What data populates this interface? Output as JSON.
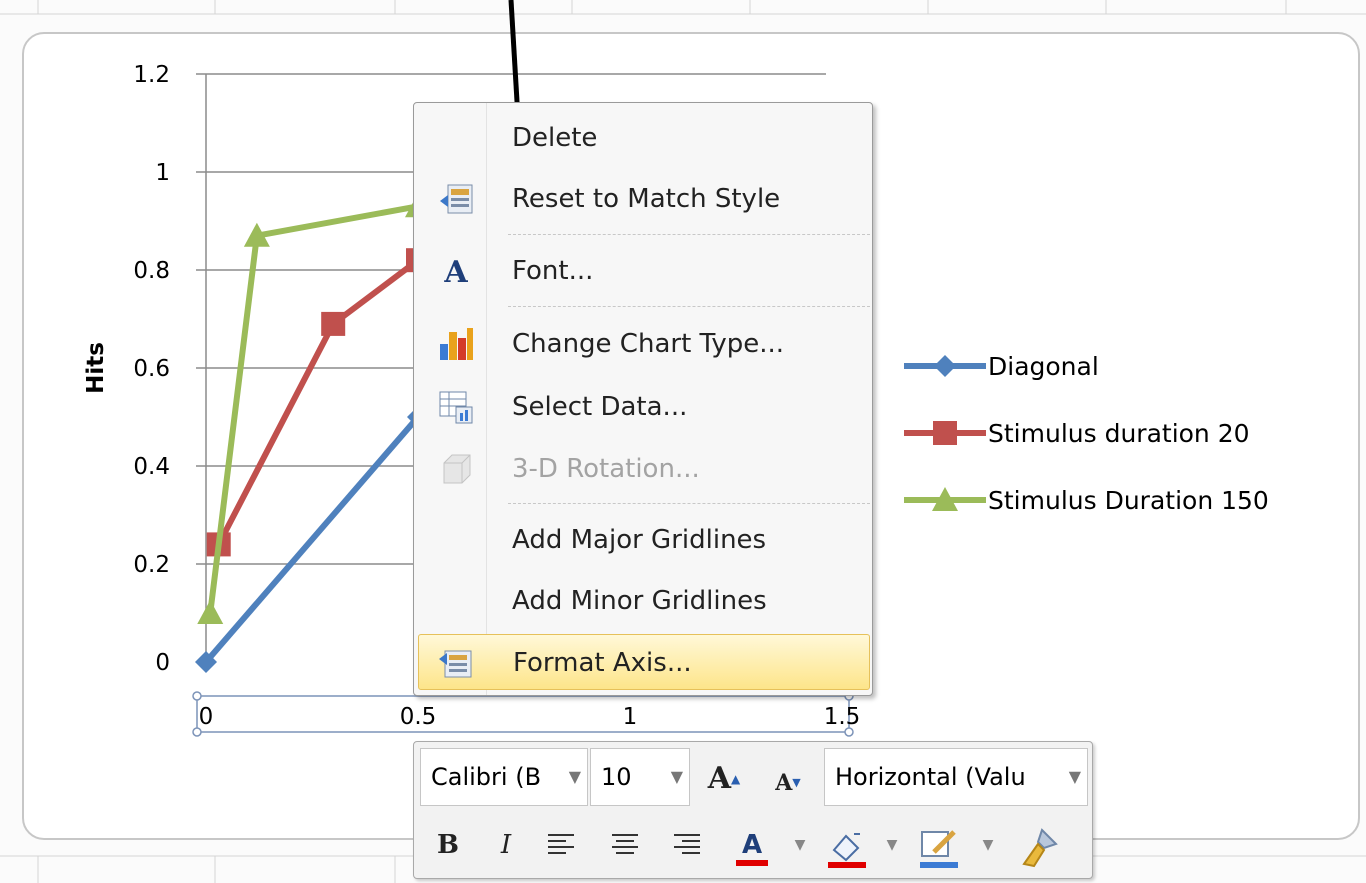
{
  "chart_data": {
    "type": "line",
    "ylabel": "Hits",
    "xlim": [
      0,
      1.5
    ],
    "ylim": [
      0,
      1.2
    ],
    "x_ticks": [
      "0",
      "0.5",
      "1",
      "1.5"
    ],
    "y_ticks": [
      "0",
      "0.2",
      "0.4",
      "0.6",
      "0.8",
      "1",
      "1.2"
    ],
    "legend_position": "right",
    "series": [
      {
        "name": "Diagonal",
        "color": "#4f81bd",
        "marker": "diamond",
        "points": [
          [
            0,
            0
          ],
          [
            0.5,
            0.5
          ]
        ]
      },
      {
        "name": "Stimulus duration 20",
        "color": "#c0504d",
        "marker": "square",
        "points": [
          [
            0.03,
            0.24
          ],
          [
            0.3,
            0.69
          ],
          [
            0.5,
            0.82
          ]
        ]
      },
      {
        "name": "Stimulus Duration 150",
        "color": "#9bbb59",
        "marker": "triangle",
        "points": [
          [
            0.01,
            0.1
          ],
          [
            0.12,
            0.87
          ],
          [
            0.5,
            0.93
          ]
        ]
      }
    ]
  },
  "context_menu": {
    "items": [
      {
        "label": "Delete",
        "icon": "none"
      },
      {
        "label": "Reset to Match Style",
        "icon": "reset-style-icon"
      },
      {
        "label": "Font...",
        "icon": "font-icon"
      },
      {
        "label": "Change Chart Type...",
        "icon": "chart-type-icon"
      },
      {
        "label": "Select Data...",
        "icon": "select-data-icon"
      },
      {
        "label": "3-D Rotation...",
        "icon": "rotation-3d-icon",
        "disabled": true
      },
      {
        "label": "Add Major Gridlines",
        "icon": "none"
      },
      {
        "label": "Add Minor Gridlines",
        "icon": "none"
      },
      {
        "label": "Format Axis...",
        "icon": "format-axis-icon",
        "highlighted": true
      }
    ]
  },
  "mini_toolbar": {
    "font_name": "Calibri (B",
    "font_size": "10",
    "element_selector": "Horizontal (Valu",
    "grow_font": "A",
    "shrink_font": "A",
    "bold": "B",
    "italic": "I",
    "font_color_letter": "A"
  }
}
